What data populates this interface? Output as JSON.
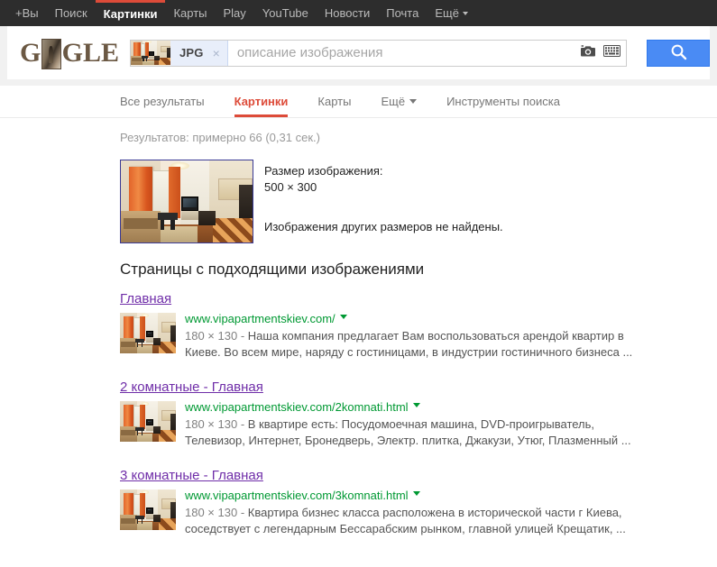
{
  "topnav": {
    "items": [
      {
        "label": "+Вы",
        "active": false,
        "caret": false
      },
      {
        "label": "Поиск",
        "active": false,
        "caret": false
      },
      {
        "label": "Картинки",
        "active": true,
        "caret": false
      },
      {
        "label": "Карты",
        "active": false,
        "caret": false
      },
      {
        "label": "Play",
        "active": false,
        "caret": false
      },
      {
        "label": "YouTube",
        "active": false,
        "caret": false
      },
      {
        "label": "Новости",
        "active": false,
        "caret": false
      },
      {
        "label": "Почта",
        "active": false,
        "caret": false
      },
      {
        "label": "Ещё",
        "active": false,
        "caret": true
      }
    ]
  },
  "header": {
    "logo_alt": "Google",
    "logo_letters": [
      "G",
      "O",
      "G",
      "L",
      "E"
    ],
    "search": {
      "chip_label": "JPG",
      "chip_close": "×",
      "placeholder": "описание изображения",
      "value": "",
      "camera_icon": "camera-icon",
      "keyboard_icon": "keyboard-icon",
      "search_icon": "magnifier-icon",
      "button_color": "#4a8bf4"
    }
  },
  "tabs": {
    "items": [
      {
        "label": "Все результаты",
        "active": false,
        "caret": false
      },
      {
        "label": "Картинки",
        "active": true,
        "caret": false
      },
      {
        "label": "Карты",
        "active": false,
        "caret": false
      },
      {
        "label": "Ещё",
        "active": false,
        "caret": true
      },
      {
        "label": "Инструменты поиска",
        "active": false,
        "caret": false
      }
    ],
    "active_color": "#dd4b39"
  },
  "results": {
    "stats": "Результатов: примерно 66 (0,31 сек.)",
    "best_guess": {
      "size_label": "Размер изображения:",
      "dimensions": "500 × 300",
      "no_other_sizes": "Изображения других размеров не найдены.",
      "thumb_alt": "Интерьер квартиры"
    },
    "pages_heading": "Страницы с подходящими изображениями",
    "items": [
      {
        "title": "Главная",
        "url": "www.vipapartmentskiev.com/",
        "dims": "180 × 130",
        "separator": " - ",
        "snippet": "Наша компания предлагает Вам воспользоваться арендой квартир в Киеве. Во всем мире, наряду с гостиницами, в индустрии гостиничного бизнеса ...",
        "thumb_alt": "Интерьер квартиры"
      },
      {
        "title": "2 комнатные - Главная",
        "url": "www.vipapartmentskiev.com/2komnati.html",
        "dims": "180 × 130",
        "separator": " - ",
        "snippet": "В квартире есть: Посудомоечная машина, DVD-проигрыватель, Телевизор, Интернет, Бронедверь, Электр. плитка, Джакузи, Утюг, Плазменный ...",
        "thumb_alt": "Интерьер квартиры"
      },
      {
        "title": "3 комнатные - Главная",
        "url": "www.vipapartmentskiev.com/3komnati.html",
        "dims": "180 × 130",
        "separator": " - ",
        "snippet": "Квартира бизнес класса расположена в исторической части г Киева, соседствует с легендарным Бессарабским рынком, главной улицей Крещатик, ...",
        "thumb_alt": "Интерьер квартиры"
      }
    ]
  },
  "colors": {
    "topbar_bg": "#2d2d2d",
    "accent_red": "#dd4b39",
    "link_visited": "#6f2da8",
    "url_green": "#009933",
    "snippet_gray": "#545454"
  }
}
